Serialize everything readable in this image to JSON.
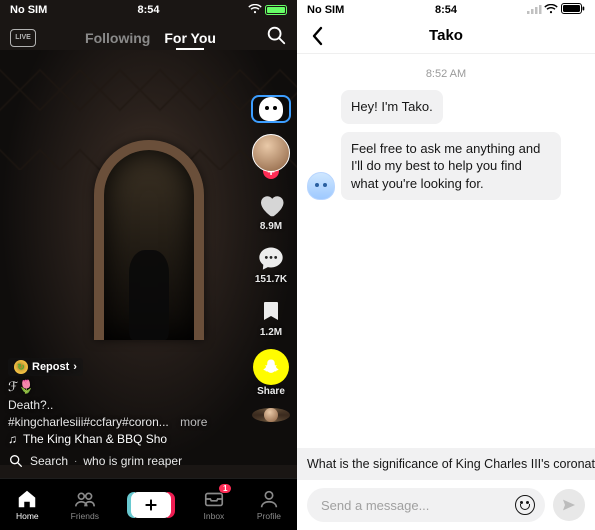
{
  "left": {
    "status": {
      "carrier": "No SIM",
      "wifi_icon": "wifi-icon",
      "time": "8:54",
      "battery_icon": "battery-charging-icon"
    },
    "live_label": "LIVE",
    "tabs": {
      "following": "Following",
      "for_you": "For You",
      "active": "for_you"
    },
    "search_icon": "search-icon",
    "rail": {
      "chatbot_icon": "chatbot-icon",
      "follow_plus": "+",
      "likes": "8.9M",
      "comments": "151.7K",
      "bookmarks": "1.2M",
      "share": "Share"
    },
    "meta": {
      "repost": "Repost",
      "repost_chevron": "›",
      "caption_prefix": "ℱ🌷",
      "caption_1": "Death?..",
      "caption_2": "#kingcharlesiii#ccfary#coron...",
      "more": "more",
      "sound_icon": "♫",
      "sound": "The King Khan & BBQ Sho"
    },
    "search_row": {
      "label": "Search",
      "dot": "·",
      "query": "who is grim reaper"
    },
    "nav": {
      "home": "Home",
      "friends": "Friends",
      "create_plus": "+",
      "inbox": "Inbox",
      "inbox_badge": "1",
      "profile": "Profile"
    }
  },
  "right": {
    "status": {
      "carrier": "No SIM",
      "time": "8:54"
    },
    "back_icon": "chevron-left-icon",
    "title": "Tako",
    "timestamp": "8:52 AM",
    "messages": [
      "Hey! I'm Tako.",
      "Feel free to ask me anything and I'll do my best to help you find what you're looking for."
    ],
    "suggestion": "What is the significance of King Charles III's coronation",
    "input_placeholder": "Send a message...",
    "emoji_icon": "smile-icon",
    "send_icon": "send-icon"
  }
}
